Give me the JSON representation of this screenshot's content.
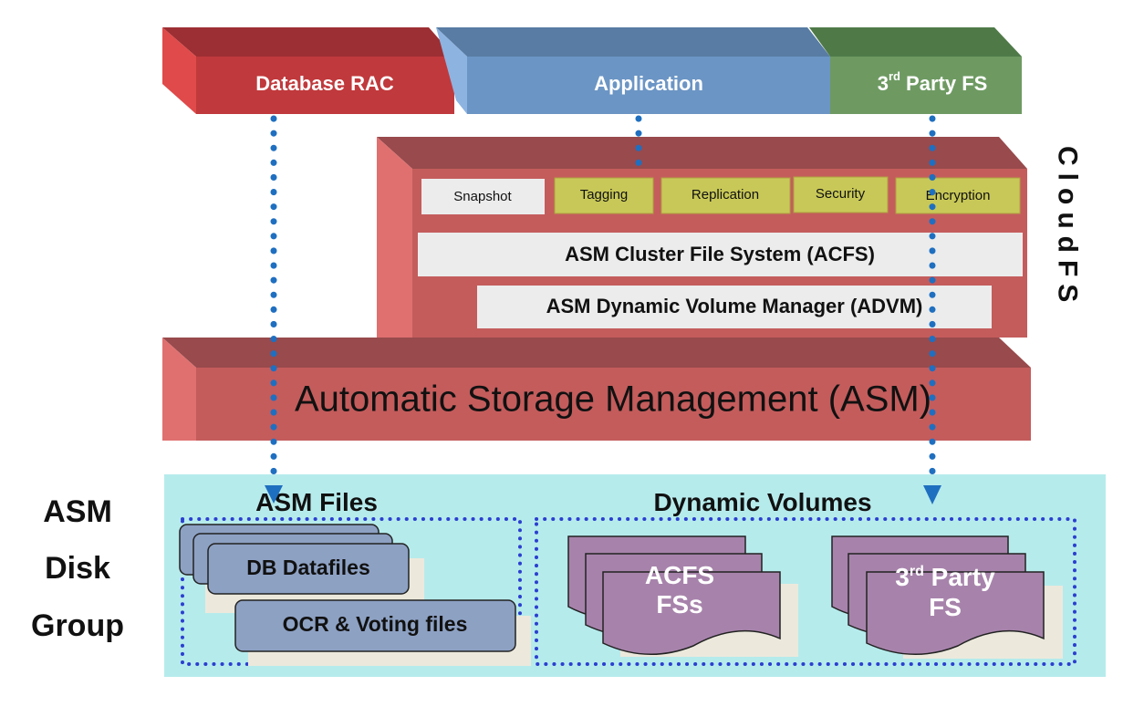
{
  "top_layers": {
    "database_rac": "Database RAC",
    "application": "Application",
    "third_party_fs": {
      "prefix": "3",
      "sup": "rd",
      "rest": " Party FS"
    }
  },
  "cloudfs": {
    "label": "CloudFS",
    "features": [
      "Snapshot",
      "Tagging",
      "Replication",
      "Security",
      "Encryption"
    ],
    "acfs": "ASM Cluster  File System (ACFS)",
    "advm": "ASM Dynamic Volume Manager (ADVM)"
  },
  "asm": "Automatic Storage Management (ASM)",
  "disk_group": {
    "label_lines": [
      "ASM",
      "Disk",
      "Group"
    ],
    "asm_files": {
      "title": "ASM Files",
      "items": [
        "DB Datafiles",
        "OCR & Voting files"
      ]
    },
    "dynamic_volumes": {
      "title": "Dynamic Volumes",
      "acfs_fss": [
        "ACFS",
        "FSs"
      ],
      "third_party": {
        "prefix": "3",
        "sup": "rd",
        "rest": " Party",
        "line2": "FS"
      }
    }
  },
  "colors": {
    "rac": "#c0393c",
    "application": "#6b95c4",
    "third_party": "#6e9a62",
    "cloudfs": "#c45c5c",
    "feature_highlight": "#c8c858",
    "disk_group_bg": "#b6ebec",
    "file_card": "#8da1c3",
    "volume": "#a783ab",
    "arrow": "#1f6fc0"
  }
}
